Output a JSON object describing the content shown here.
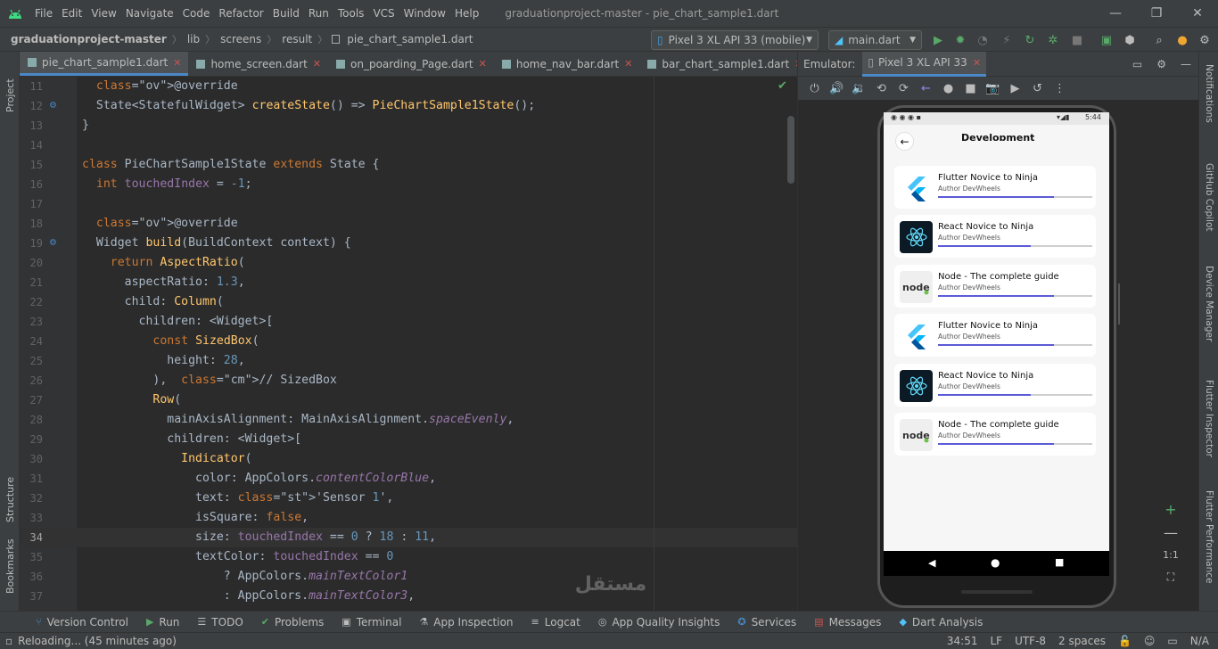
{
  "menu": {
    "items": [
      "File",
      "Edit",
      "View",
      "Navigate",
      "Code",
      "Refactor",
      "Build",
      "Run",
      "Tools",
      "VCS",
      "Window",
      "Help"
    ],
    "window_title": "graduationproject-master - pie_chart_sample1.dart"
  },
  "breadcrumb": [
    "graduationproject-master",
    "lib",
    "screens",
    "result",
    "pie_chart_sample1.dart"
  ],
  "run_config": {
    "device": "Pixel 3 XL API 33 (mobile)",
    "target": "main.dart"
  },
  "tabs": [
    {
      "label": "pie_chart_sample1.dart"
    },
    {
      "label": "home_screen.dart"
    },
    {
      "label": "on_poarding_Page.dart"
    },
    {
      "label": "home_nav_bar.dart"
    },
    {
      "label": "bar_chart_sample1.dart"
    }
  ],
  "left_tools": {
    "project": "Project",
    "structure": "Structure",
    "bookmarks": "Bookmarks"
  },
  "right_tools": [
    "Notifications",
    "GitHub Copilot",
    "Device Manager",
    "Flutter Inspector",
    "Flutter Performance"
  ],
  "emulator": {
    "label": "Emulator:",
    "tab": "Pixel 3 XL API 33"
  },
  "code_lines": [
    {
      "n": "11",
      "t": "  @override"
    },
    {
      "n": "12",
      "t": "  State<StatefulWidget> createState() => PieChartSample1State();"
    },
    {
      "n": "13",
      "t": "}"
    },
    {
      "n": "14",
      "t": ""
    },
    {
      "n": "15",
      "t": "class PieChartSample1State extends State {"
    },
    {
      "n": "16",
      "t": "  int touchedIndex = -1;"
    },
    {
      "n": "17",
      "t": ""
    },
    {
      "n": "18",
      "t": "  @override"
    },
    {
      "n": "19",
      "t": "  Widget build(BuildContext context) {"
    },
    {
      "n": "20",
      "t": "    return AspectRatio("
    },
    {
      "n": "21",
      "t": "      aspectRatio: 1.3,"
    },
    {
      "n": "22",
      "t": "      child: Column("
    },
    {
      "n": "23",
      "t": "        children: <Widget>["
    },
    {
      "n": "24",
      "t": "          const SizedBox("
    },
    {
      "n": "25",
      "t": "            height: 28,"
    },
    {
      "n": "26",
      "t": "          ),  // SizedBox"
    },
    {
      "n": "27",
      "t": "          Row("
    },
    {
      "n": "28",
      "t": "            mainAxisAlignment: MainAxisAlignment.spaceEvenly,"
    },
    {
      "n": "29",
      "t": "            children: <Widget>["
    },
    {
      "n": "30",
      "t": "              Indicator("
    },
    {
      "n": "31",
      "t": "                color: AppColors.contentColorBlue,"
    },
    {
      "n": "32",
      "t": "                text: 'Sensor 1',"
    },
    {
      "n": "33",
      "t": "                isSquare: false,"
    },
    {
      "n": "34",
      "t": "                size: touchedIndex == 0 ? 18 : 11,"
    },
    {
      "n": "35",
      "t": "                textColor: touchedIndex == 0"
    },
    {
      "n": "36",
      "t": "                    ? AppColors.mainTextColor1"
    },
    {
      "n": "37",
      "t": "                    : AppColors.mainTextColor3,"
    }
  ],
  "phone": {
    "time": "5:44",
    "header": "Development",
    "courses": [
      {
        "title": "Flutter Novice to Ninja",
        "author": "Author DevWheels",
        "progress": 0.75,
        "logo": "flutter"
      },
      {
        "title": "React Novice to Ninja",
        "author": "Author DevWheels",
        "progress": 0.6,
        "logo": "react"
      },
      {
        "title": "Node - The complete guide",
        "author": "Author DevWheels",
        "progress": 0.75,
        "logo": "node"
      },
      {
        "title": "Flutter Novice to Ninja",
        "author": "Author DevWheels",
        "progress": 0.75,
        "logo": "flutter"
      },
      {
        "title": "React Novice to Ninja",
        "author": "Author DevWheels",
        "progress": 0.6,
        "logo": "react"
      },
      {
        "title": "Node - The complete guide",
        "author": "Author DevWheels",
        "progress": 0.75,
        "logo": "node"
      }
    ]
  },
  "bottom_tools": [
    "Version Control",
    "Run",
    "TODO",
    "Problems",
    "Terminal",
    "App Inspection",
    "Logcat",
    "App Quality Insights",
    "Services",
    "Messages",
    "Dart Analysis"
  ],
  "status": {
    "left": "Reloading... (45 minutes ago)",
    "position": "34:51",
    "line_sep": "LF",
    "encoding": "UTF-8",
    "indent": "2 spaces",
    "na": "N/A"
  },
  "zoom": {
    "label": "1:1"
  },
  "watermark": "مستقل mostaql.com"
}
